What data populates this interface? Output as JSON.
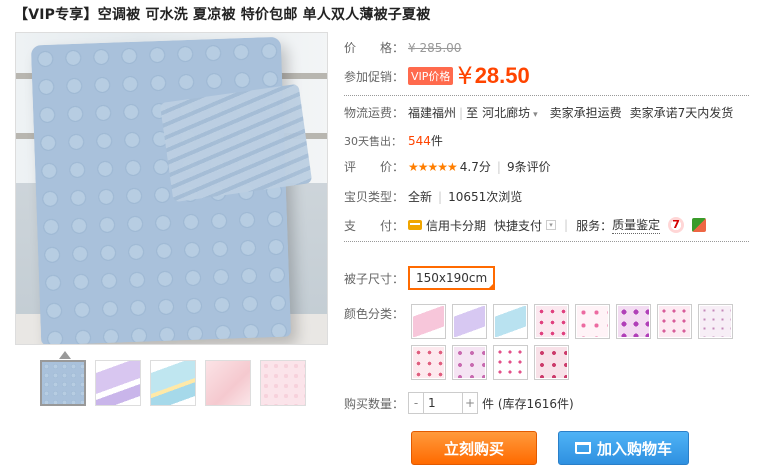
{
  "title": "【VIP专享】空调被 可水洗 夏凉被 特价包邮 单人双人薄被子夏被",
  "price": {
    "label": "价　　格：",
    "value": "¥ 285.00"
  },
  "promo": {
    "label": "参加促销：",
    "tag": "VIP价格",
    "yen": "¥",
    "value": "28.50"
  },
  "shipping": {
    "label": "物流运费：",
    "from": "福建福州",
    "to_sep": "至",
    "to": "河北廊坊",
    "fee": "卖家承担运费",
    "promise": "卖家承诺7天内发货"
  },
  "sales": {
    "label": "30天售出：",
    "count": "544",
    "unit": "件"
  },
  "rating": {
    "label": "评　　价：",
    "stars": "★★★★★",
    "score": "4.7分",
    "reviews": "9条评价"
  },
  "type": {
    "label": "宝贝类型：",
    "condition": "全新",
    "views": "10651次浏览"
  },
  "payment": {
    "label": "支　　付：",
    "credit": "信用卡分期",
    "quick": "快捷支付",
    "service_label": "服务：",
    "service": "质量鉴定",
    "badge7": "7"
  },
  "size": {
    "label": "被子尺寸：",
    "value": "150x190cm"
  },
  "color": {
    "label": "颜色分类："
  },
  "quantity": {
    "label": "购买数量：",
    "minus": "-",
    "value": "1",
    "plus": "+",
    "stock": "件 (库存1616件)"
  },
  "buttons": {
    "buy": "立刻购买",
    "cart": "加入购物车"
  },
  "colors": {
    "accent": "#ff4400",
    "buy": "#ff6a00",
    "cart": "#2f90e0"
  }
}
